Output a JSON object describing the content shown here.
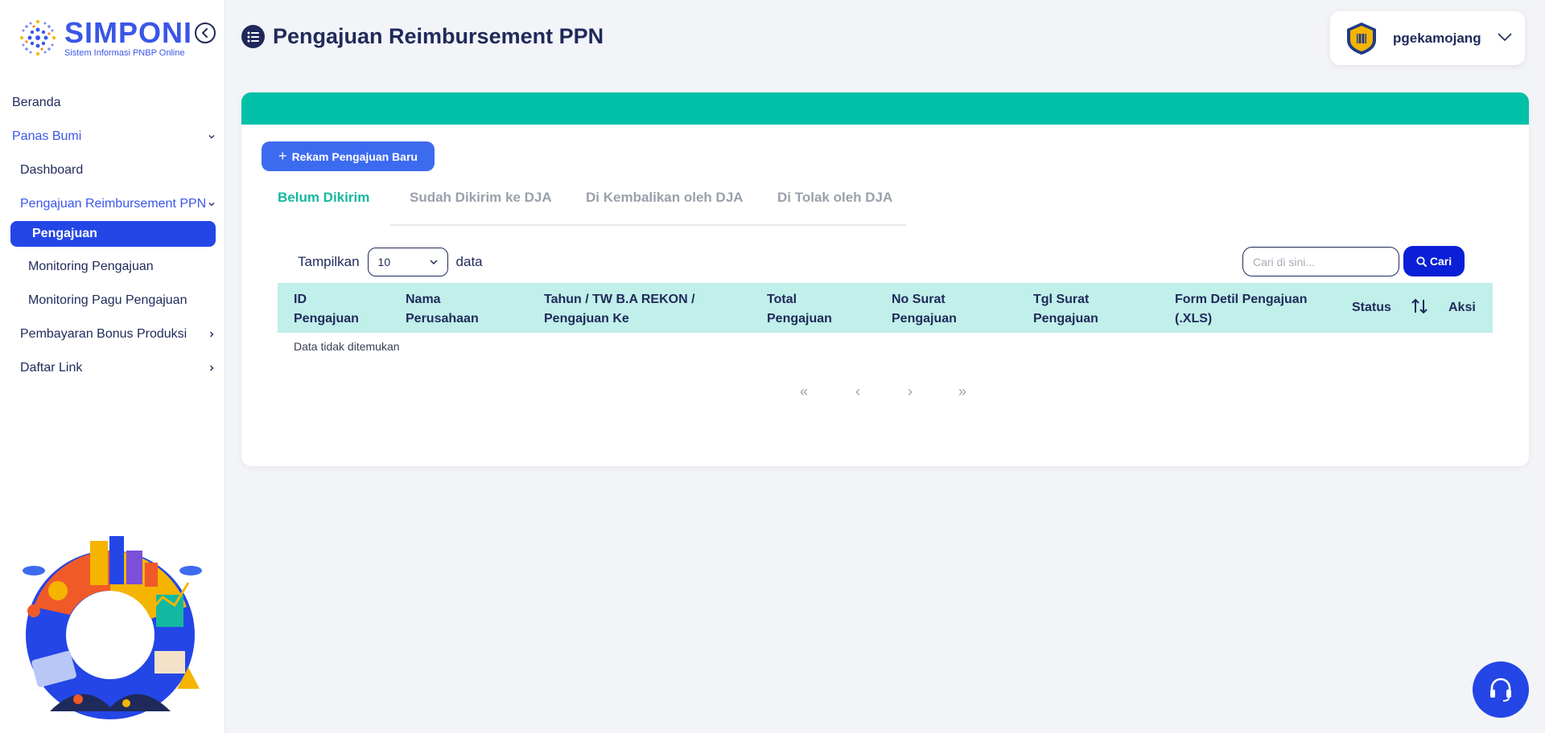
{
  "brand": {
    "name": "SIMPONI",
    "tagline": "Sistem Informasi PNBP Online"
  },
  "sidebar": {
    "items": [
      {
        "label": "Beranda"
      },
      {
        "label": "Panas Bumi"
      },
      {
        "label": "Dashboard"
      },
      {
        "label": "Pengajuan Reimbursement PPN"
      },
      {
        "label": "Pengajuan"
      },
      {
        "label": "Monitoring Pengajuan"
      },
      {
        "label": "Monitoring Pagu Pengajuan"
      },
      {
        "label": "Pembayaran Bonus Produksi"
      },
      {
        "label": "Daftar Link"
      }
    ]
  },
  "header": {
    "title": "Pengajuan Reimbursement PPN"
  },
  "user": {
    "name": "pgekamojang"
  },
  "toolbar": {
    "new_label": "Rekam Pengajuan Baru"
  },
  "tabs": [
    {
      "label": "Belum Dikirim"
    },
    {
      "label": "Sudah Dikirim ke DJA"
    },
    {
      "label": "Di Kembalikan oleh DJA"
    },
    {
      "label": "Di Tolak oleh DJA"
    }
  ],
  "table_controls": {
    "show_label": "Tampilkan",
    "page_size": "10",
    "data_label": "data",
    "search_placeholder": "Cari di sini...",
    "search_button": "Cari"
  },
  "table": {
    "columns": [
      {
        "line1": "ID",
        "line2": "Pengajuan"
      },
      {
        "line1": "Nama",
        "line2": "Perusahaan"
      },
      {
        "line1": "Tahun / TW B.A REKON /",
        "line2": "Pengajuan Ke"
      },
      {
        "line1": "Total",
        "line2": "Pengajuan"
      },
      {
        "line1": "No Surat",
        "line2": "Pengajuan"
      },
      {
        "line1": "Tgl Surat",
        "line2": "Pengajuan"
      },
      {
        "line1": "Form Detil Pengajuan",
        "line2": "(.XLS)"
      },
      {
        "line1": "Status",
        "line2": ""
      },
      {
        "line1": "Aksi",
        "line2": ""
      }
    ],
    "empty_text": "Data tidak ditemukan"
  },
  "pagination": {
    "first": "«",
    "prev": "‹",
    "next": "›",
    "last": "»"
  },
  "colors": {
    "primary": "#2446e6",
    "accent_teal": "#00c0a8",
    "header_teal": "#c1efea",
    "navy": "#1f2a5a"
  },
  "icons": [
    "collapse-icon",
    "list-icon",
    "chevron-down-icon",
    "chevron-right-icon",
    "plus-icon",
    "search-icon",
    "sort-icon",
    "headset-icon"
  ]
}
